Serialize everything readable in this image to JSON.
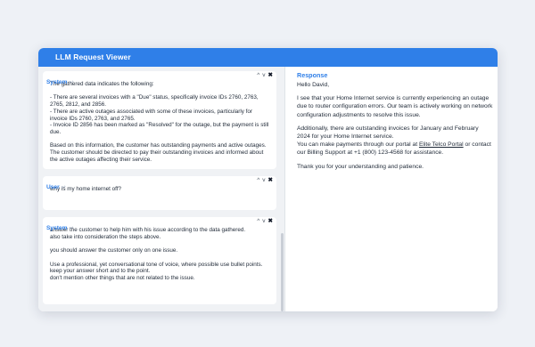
{
  "window": {
    "title": "LLM Request Viewer"
  },
  "messages": [
    {
      "role": "System",
      "text": "The gathered data indicates the following:\n\n- There are several invoices with a \"Due\" status, specifically invoice IDs 2760, 2763, 2765, 2812, and 2856.\n- There are active outages associated with some of these invoices, particularly for invoice IDs 2760, 2763, and 2765.\n- Invoice ID 2856 has been marked as \"Resolved\" for the outage, but the payment is still due.\n\nBased on this information, the customer has outstanding payments and active outages. The customer should be directed to pay their outstanding invoices and informed about the active outages affecting their service."
    },
    {
      "role": "User",
      "text": "why is my home internet off?"
    },
    {
      "role": "System",
      "text": "answer the customer to help him with his issue according to the data gathered.\nalso take into consideration the steps above.\n\nyou should answer the customer only on one issue.\n\nUse a professional, yet conversational tone of voice, where possible use bullet points.\nkeep your answer short and to the point.\ndon't mention other things that are not related to the issue."
    }
  ],
  "controls": {
    "up": "^",
    "down": "v",
    "close": "✖"
  },
  "response": {
    "title": "Response",
    "greeting": "Hello David,",
    "p1": "I see that your Home Internet service is currently experiencing an outage due to router configuration errors. Our team is actively working on network configuration adjustments to resolve this issue.",
    "p2a": "Additionally, there are outstanding invoices for January and February 2024 for your Home Internet service.",
    "p2b_pre": "You can make payments through our portal at ",
    "link": "Elite Telco Portal",
    "p2b_post": " or contact our Billing Support at +1 (800) 123-4568 for assistance.",
    "closing": "Thank you for your understanding and patience."
  },
  "colors": {
    "accent": "#2f7fe8",
    "panel": "#f0f2f5",
    "page": "#eef1f6"
  }
}
